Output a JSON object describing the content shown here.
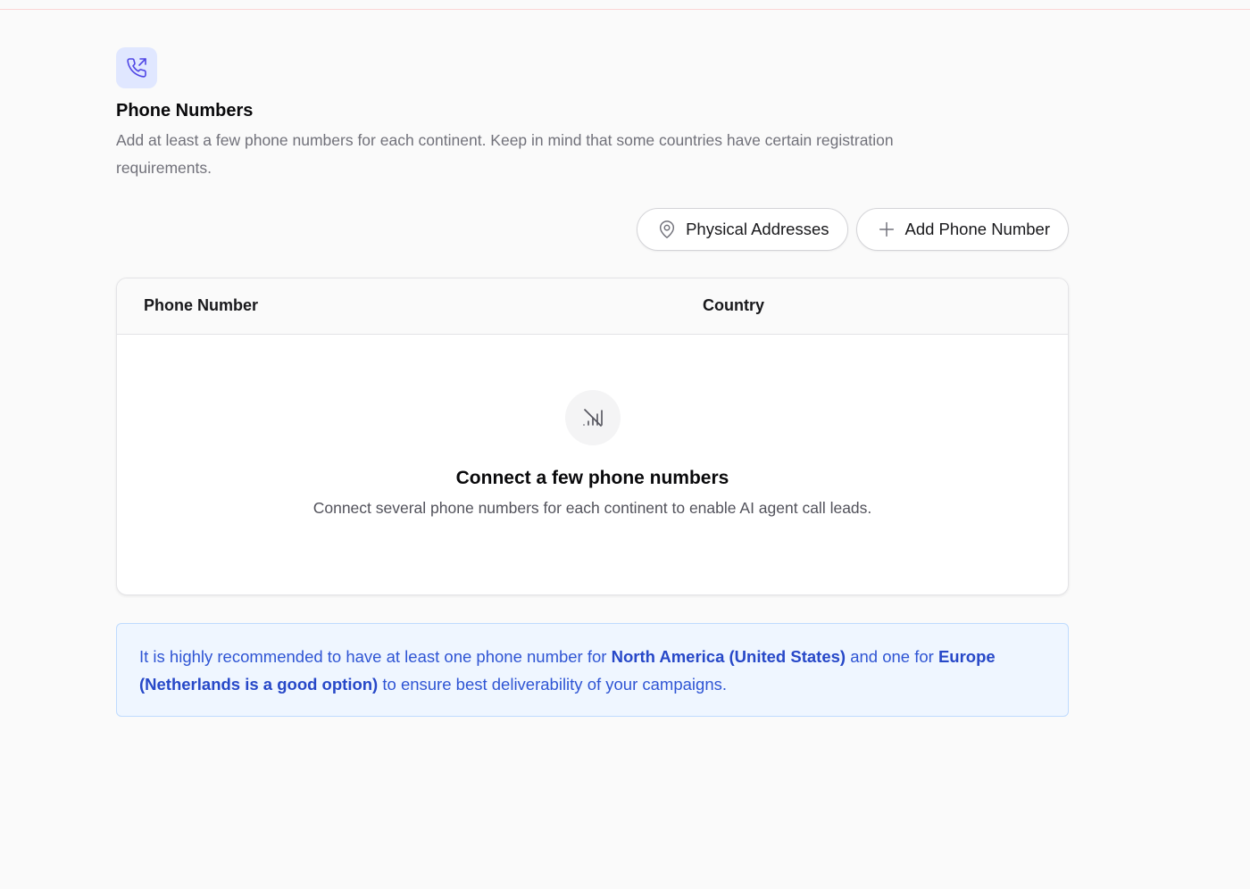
{
  "header": {
    "icon": "phone-outgoing-icon",
    "title": "Phone Numbers",
    "description": "Add at least a few phone numbers for each continent. Keep in mind that some countries have certain registration requirements."
  },
  "actions": {
    "physical_addresses": {
      "label": "Physical Addresses",
      "icon": "map-pin-icon"
    },
    "add_phone_number": {
      "label": "Add Phone Number",
      "icon": "plus-icon"
    }
  },
  "table": {
    "columns": [
      "Phone Number",
      "Country"
    ],
    "rows": [],
    "empty": {
      "icon": "signal-off-icon",
      "title": "Connect a few phone numbers",
      "description": "Connect several phone numbers for each continent to enable AI agent call leads."
    }
  },
  "notice": {
    "text_1": "It is highly recommended to have at least one phone number for ",
    "bold_1": "North America (United States)",
    "text_2": " and one for ",
    "bold_2": "Europe (Netherlands is a good option)",
    "text_3": " to ensure best deliverability of your campaigns."
  },
  "colors": {
    "accent_bg": "#e0e7ff",
    "accent_icon": "#4f46e5",
    "notice_bg": "#eff6ff",
    "notice_text": "#2f55d4"
  }
}
